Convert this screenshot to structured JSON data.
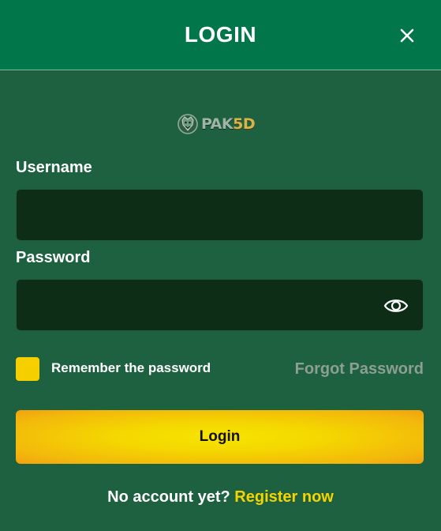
{
  "header": {
    "title": "LOGIN",
    "close_icon": "close-icon"
  },
  "logo": {
    "text_part1": "PAK",
    "text_part2": "5D",
    "emblem_icon": "lion-emblem-icon"
  },
  "form": {
    "username_label": "Username",
    "username_value": "",
    "password_label": "Password",
    "password_value": "",
    "eye_icon": "eye-icon",
    "remember_label": "Remember the password",
    "remember_checked": false,
    "forgot_label": "Forgot Password",
    "login_label": "Login"
  },
  "footer": {
    "prompt": "No account yet?",
    "register_label": "Register now"
  },
  "colors": {
    "header_bg": "#00764a",
    "body_bg": "#1d6140",
    "input_bg": "#0d2d17",
    "accent_yellow": "#f6d400",
    "muted_link": "#8c9f92"
  }
}
